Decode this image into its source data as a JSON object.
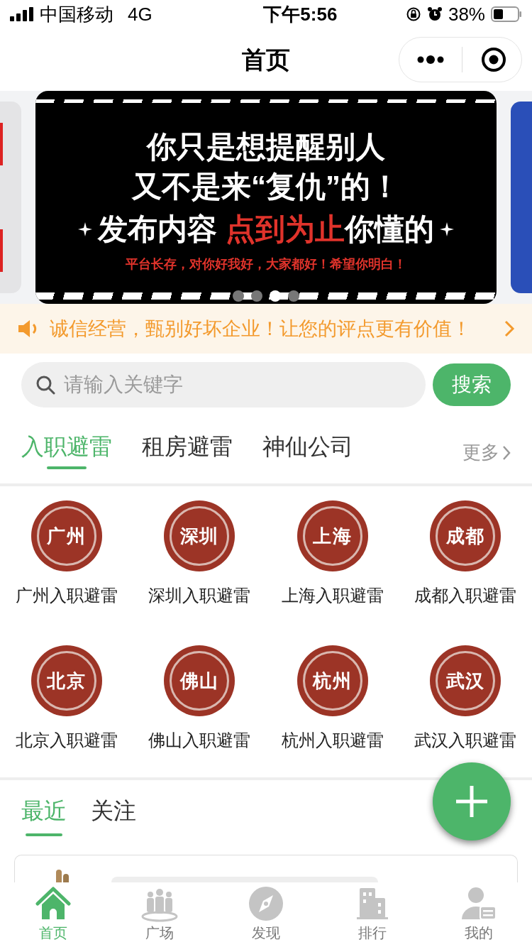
{
  "status_bar": {
    "carrier": "中国移动",
    "network": "4G",
    "time": "下午5:56",
    "battery": "38%"
  },
  "nav": {
    "title": "首页"
  },
  "banner": {
    "lines": [
      "你只是想提醒别人",
      "又不是来“复仇”的！"
    ],
    "highlight_line": {
      "before": "发布内容",
      "accent": "点到为止",
      "after": "你懂的"
    },
    "footer": "平台长存，对你好我好，大家都好！希望你明白！",
    "dots": [
      {
        "selected": false
      },
      {
        "selected": false
      },
      {
        "selected": true
      },
      {
        "selected": false
      }
    ]
  },
  "notice": {
    "text": "诚信经营，甄别好坏企业！让您的评点更有价值！"
  },
  "search": {
    "placeholder": "请输入关键字",
    "button": "搜索"
  },
  "category_tabs": [
    {
      "label": "入职避雷",
      "selected": true
    },
    {
      "label": "租房避雷",
      "selected": false
    },
    {
      "label": "神仙公司",
      "selected": false
    }
  ],
  "more": "更多",
  "cities": [
    {
      "seal": "广州",
      "label": "广州入职避雷"
    },
    {
      "seal": "深圳",
      "label": "深圳入职避雷"
    },
    {
      "seal": "上海",
      "label": "上海入职避雷"
    },
    {
      "seal": "成都",
      "label": "成都入职避雷"
    },
    {
      "seal": "北京",
      "label": "北京入职避雷"
    },
    {
      "seal": "佛山",
      "label": "佛山入职避雷"
    },
    {
      "seal": "杭州",
      "label": "杭州入职避雷"
    },
    {
      "seal": "武汉",
      "label": "武汉入职避雷"
    }
  ],
  "feed_tabs": [
    {
      "label": "最近",
      "selected": true
    },
    {
      "label": "关注",
      "selected": false
    }
  ],
  "tab_bar": [
    {
      "label": "首页",
      "kind": "home",
      "selected": true
    },
    {
      "label": "广场",
      "kind": "people",
      "selected": false
    },
    {
      "label": "发现",
      "kind": "compass",
      "selected": false
    },
    {
      "label": "排行",
      "kind": "buildings",
      "selected": false
    },
    {
      "label": "我的",
      "kind": "user",
      "selected": false
    }
  ]
}
